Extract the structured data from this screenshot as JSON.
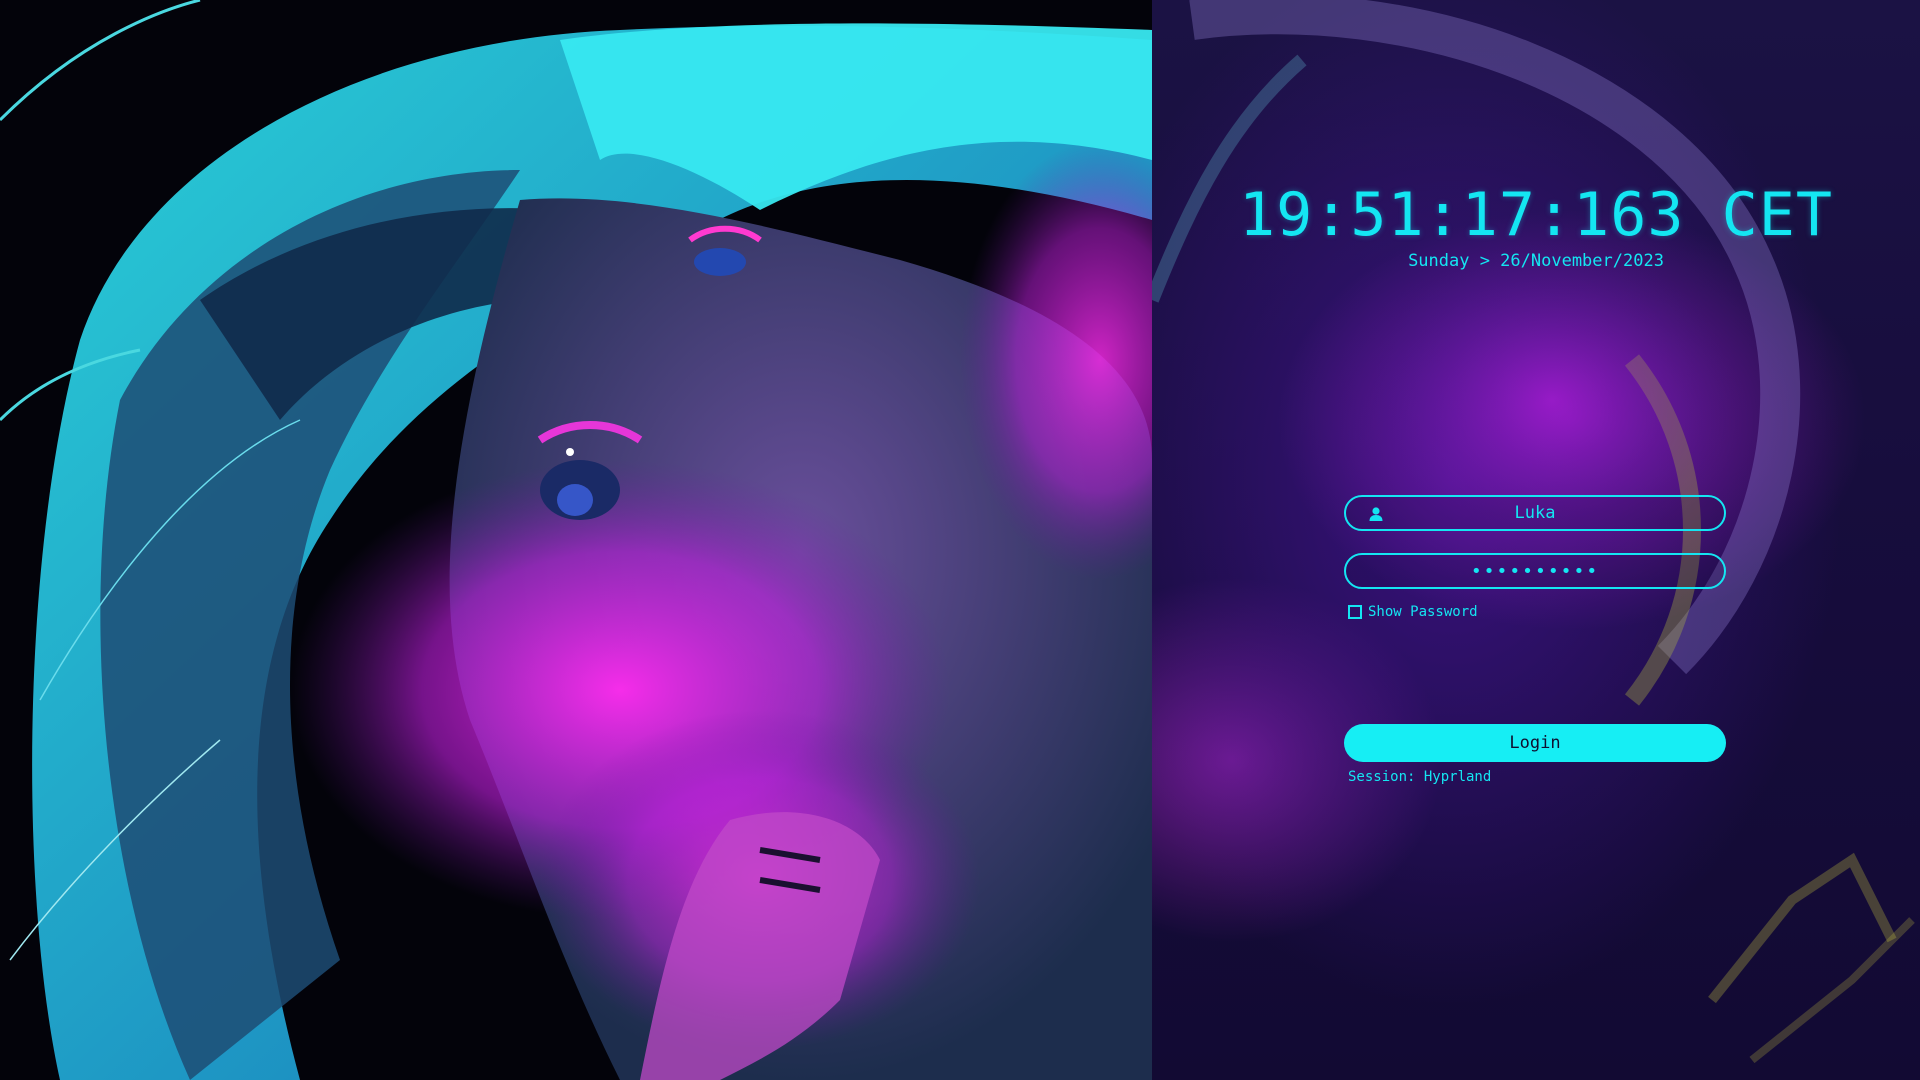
{
  "clock": {
    "time": "19:51:17:163 CET",
    "date": "Sunday > 26/November/2023"
  },
  "login": {
    "username": "Luka",
    "password_mask": "••••••••••",
    "show_password_label": "Show Password",
    "show_password_checked": false,
    "login_label": "Login",
    "session_label": "Session: Hyprland"
  },
  "icons": {
    "user": "user-icon",
    "checkbox": "checkbox-icon"
  },
  "colors": {
    "accent": "#14e6f2",
    "panel_bg": "#170d3d",
    "button_bg": "#16eef4",
    "button_text": "#101030"
  }
}
